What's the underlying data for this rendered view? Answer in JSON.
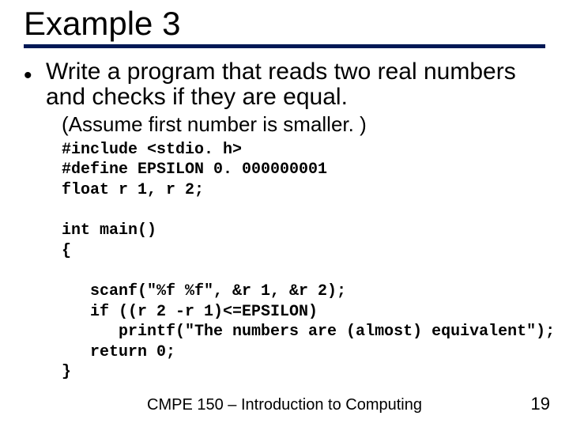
{
  "title": "Example 3",
  "bullet": "Write a program that reads two real numbers and checks if they are equal.",
  "assumption": "(Assume first number is smaller. )",
  "code": "#include <stdio. h>\n#define EPSILON 0. 000000001\nfloat r 1, r 2;\n\nint main()\n{\n\n   scanf(\"%f %f\", &r 1, &r 2);\n   if ((r 2 -r 1)<=EPSILON)\n      printf(\"The numbers are (almost) equivalent\");\n   return 0;\n}",
  "footer": "CMPE 150 – Introduction to Computing",
  "page": "19"
}
